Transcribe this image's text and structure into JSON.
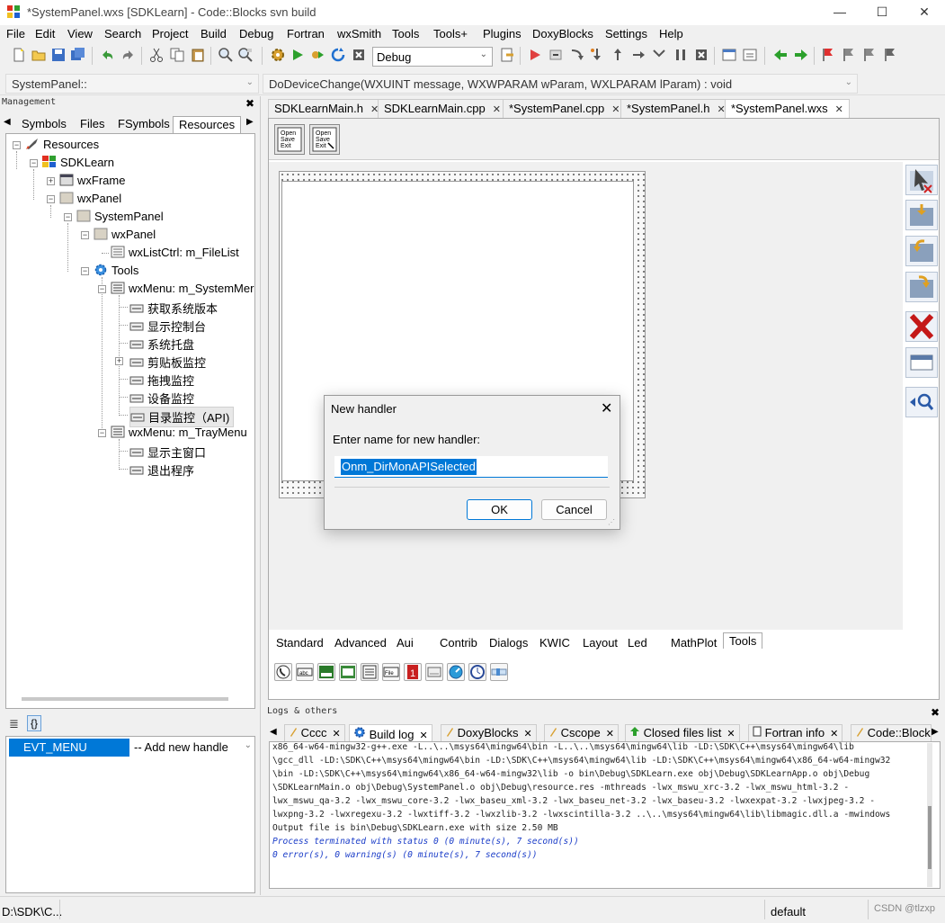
{
  "window": {
    "title": "*SystemPanel.wxs [SDKLearn] - Code::Blocks svn build",
    "min_icon": "—",
    "max_icon": "☐",
    "close_icon": "✕"
  },
  "menu": [
    "File",
    "Edit",
    "View",
    "Search",
    "Project",
    "Build",
    "Debug",
    "Fortran",
    "wxSmith",
    "Tools",
    "Tools+",
    "Plugins",
    "DoxyBlocks",
    "Settings",
    "Help"
  ],
  "toolbar": {
    "build_target": "Debug"
  },
  "code_completion": {
    "scope": "SystemPanel::",
    "function": "DoDeviceChange(WXUINT message, WXWPARAM wParam, WXLPARAM lParam) : void"
  },
  "management": {
    "title": "Management",
    "tabs": [
      "Symbols",
      "Files",
      "FSymbols",
      "Resources"
    ],
    "active_tab": "Resources",
    "tree": [
      {
        "label": "Resources"
      },
      {
        "label": "SDKLearn"
      },
      {
        "label": "wxFrame"
      },
      {
        "label": "wxPanel"
      },
      {
        "label": "SystemPanel"
      },
      {
        "label": "wxPanel"
      },
      {
        "label": "wxListCtrl: m_FileList"
      },
      {
        "label": "Tools"
      },
      {
        "label": "wxMenu: m_SystemMer"
      },
      {
        "label": "获取系统版本"
      },
      {
        "label": "显示控制台"
      },
      {
        "label": "系统托盘"
      },
      {
        "label": "剪贴板监控"
      },
      {
        "label": "拖拽监控"
      },
      {
        "label": "设备监控"
      },
      {
        "label": "目录监控（API)"
      },
      {
        "label": "wxMenu: m_TrayMenu"
      },
      {
        "label": "显示主窗口"
      },
      {
        "label": "退出程序"
      }
    ],
    "properties": {
      "tab_icon_1": "≣",
      "tab_icon_2": "{}",
      "event_name": "EVT_MENU",
      "event_value": "-- Add new handle"
    }
  },
  "editor_tabs": [
    {
      "label": "SDKLearnMain.h",
      "active": false
    },
    {
      "label": "SDKLearnMain.cpp",
      "active": false
    },
    {
      "label": "*SystemPanel.cpp",
      "active": false
    },
    {
      "label": "*SystemPanel.h",
      "active": false
    },
    {
      "label": "*SystemPanel.wxs",
      "active": true
    }
  ],
  "designer": {
    "palette_tabs": [
      "Standard",
      "Advanced",
      "Aui",
      "Contrib",
      "Dialogs",
      "KWIC",
      "Layout",
      "Led",
      "MathPlot",
      "Tools"
    ],
    "active_palette": "Tools",
    "toolbar_button_text": "Open\nSave\nExit"
  },
  "logs": {
    "title": "Logs & others",
    "tabs": [
      {
        "label": "Cccc",
        "active": false
      },
      {
        "label": "Build log",
        "active": true
      },
      {
        "label": "DoxyBlocks",
        "active": false
      },
      {
        "label": "Cscope",
        "active": false
      },
      {
        "label": "Closed files list",
        "active": false
      },
      {
        "label": "Fortran info",
        "active": false
      },
      {
        "label": "Code::Block",
        "active": false
      }
    ],
    "lines": [
      "x86_64-w64-mingw32-g++.exe -L..\\..\\msys64\\mingw64\\bin -L..\\..\\msys64\\mingw64\\lib -LD:\\SDK\\C++\\msys64\\mingw64\\lib",
      "\\gcc_dll -LD:\\SDK\\C++\\msys64\\mingw64\\bin -LD:\\SDK\\C++\\msys64\\mingw64\\lib -LD:\\SDK\\C++\\msys64\\mingw64\\x86_64-w64-mingw32",
      "\\bin -LD:\\SDK\\C++\\msys64\\mingw64\\x86_64-w64-mingw32\\lib -o bin\\Debug\\SDKLearn.exe  obj\\Debug\\SDKLearnApp.o obj\\Debug",
      "\\SDKLearnMain.o obj\\Debug\\SystemPanel.o obj\\Debug\\resource.res -mthreads -lwx_mswu_xrc-3.2 -lwx_mswu_html-3.2 -",
      "lwx_mswu_qa-3.2 -lwx_mswu_core-3.2 -lwx_baseu_xml-3.2 -lwx_baseu_net-3.2 -lwx_baseu-3.2 -lwxexpat-3.2 -lwxjpeg-3.2 -",
      "lwxpng-3.2 -lwxregexu-3.2 -lwxtiff-3.2 -lwxzlib-3.2 -lwxscintilla-3.2  ..\\..\\msys64\\mingw64\\lib\\libmagic.dll.a -mwindows",
      "Output file is bin\\Debug\\SDKLearn.exe with size 2.50 MB",
      "Process terminated with status 0 (0 minute(s), 7 second(s))",
      "0 error(s), 0 warning(s) (0 minute(s), 7 second(s))"
    ]
  },
  "status": {
    "path": "D:\\SDK\\C...",
    "encoding": "default",
    "watermark": "CSDN @tlzxp"
  },
  "dialog": {
    "title": "New handler",
    "prompt": "Enter name for new handler:",
    "input_value": "Onm_DirMonAPISelected",
    "ok_label": "OK",
    "cancel_label": "Cancel"
  }
}
